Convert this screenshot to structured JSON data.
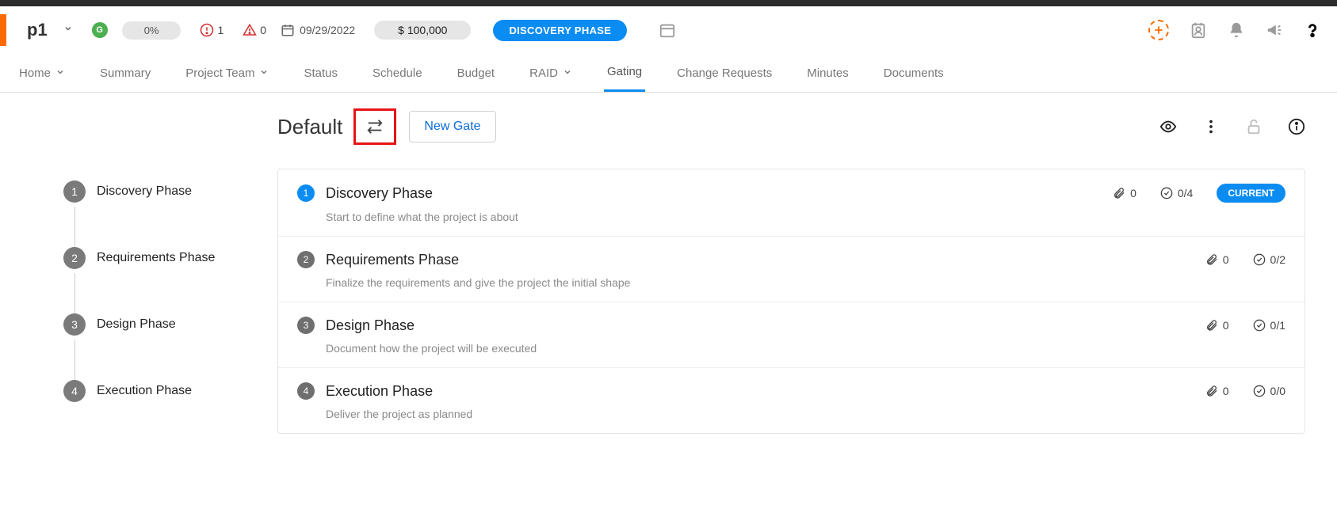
{
  "project": {
    "name": "p1",
    "status_letter": "G",
    "progress": "0%",
    "issues_count": "1",
    "risks_count": "0",
    "date": "09/29/2022",
    "budget": "$ 100,000",
    "phase_badge": "DISCOVERY PHASE"
  },
  "tabs": [
    {
      "label": "Home",
      "dropdown": true,
      "active": false
    },
    {
      "label": "Summary",
      "dropdown": false,
      "active": false
    },
    {
      "label": "Project Team",
      "dropdown": true,
      "active": false
    },
    {
      "label": "Status",
      "dropdown": false,
      "active": false
    },
    {
      "label": "Schedule",
      "dropdown": false,
      "active": false
    },
    {
      "label": "Budget",
      "dropdown": false,
      "active": false
    },
    {
      "label": "RAID",
      "dropdown": true,
      "active": false
    },
    {
      "label": "Gating",
      "dropdown": false,
      "active": true
    },
    {
      "label": "Change Requests",
      "dropdown": false,
      "active": false
    },
    {
      "label": "Minutes",
      "dropdown": false,
      "active": false
    },
    {
      "label": "Documents",
      "dropdown": false,
      "active": false
    }
  ],
  "side_steps": [
    {
      "num": "1",
      "label": "Discovery Phase"
    },
    {
      "num": "2",
      "label": "Requirements Phase"
    },
    {
      "num": "3",
      "label": "Design Phase"
    },
    {
      "num": "4",
      "label": "Execution Phase"
    }
  ],
  "gating": {
    "title": "Default",
    "new_gate_label": "New Gate",
    "gates": [
      {
        "num": "1",
        "name": "Discovery Phase",
        "desc": "Start to define what the project is about",
        "attachments": "0",
        "checks": "0/4",
        "current": true,
        "current_label": "CURRENT"
      },
      {
        "num": "2",
        "name": "Requirements Phase",
        "desc": "Finalize the requirements and give the project the initial shape",
        "attachments": "0",
        "checks": "0/2",
        "current": false
      },
      {
        "num": "3",
        "name": "Design Phase",
        "desc": "Document how the project will be executed",
        "attachments": "0",
        "checks": "0/1",
        "current": false
      },
      {
        "num": "4",
        "name": "Execution Phase",
        "desc": "Deliver the project as planned",
        "attachments": "0",
        "checks": "0/0",
        "current": false
      }
    ]
  }
}
